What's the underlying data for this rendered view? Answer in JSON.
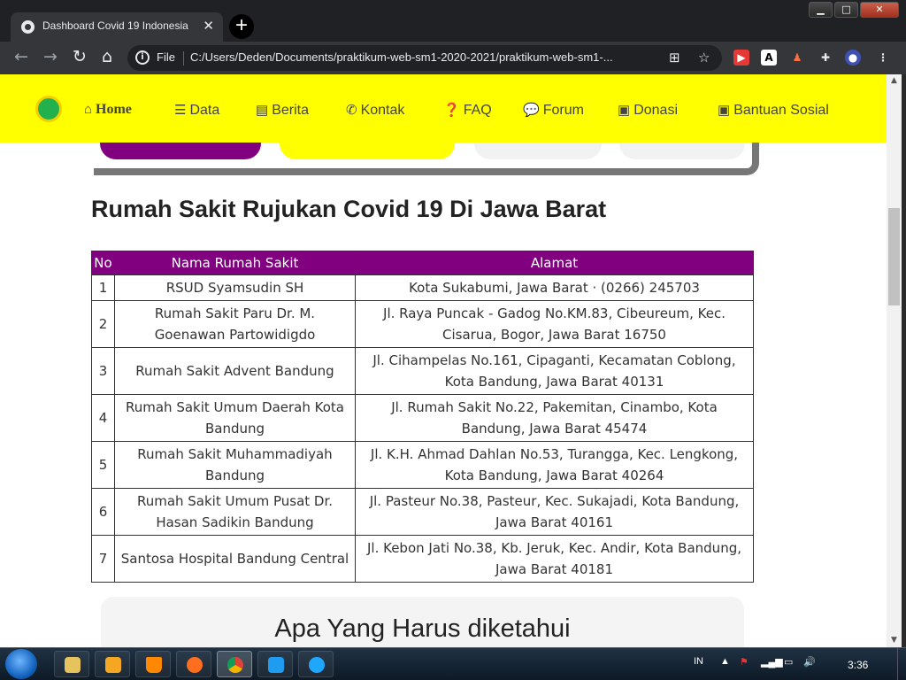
{
  "browser": {
    "tab_title": "Dashboard Covid 19 Indonesia",
    "tab_close": "✕",
    "new_tab": "+",
    "file_label": "File",
    "url": "C:/Users/Deden/Documents/praktikum-web-sm1-2020-2021/praktikum-web-sm1-...",
    "window_buttons": {
      "minimize": "▁",
      "maximize": "□",
      "close": "✕"
    }
  },
  "site_nav": {
    "items": [
      {
        "icon": "home-icon",
        "label": "Home",
        "active": true
      },
      {
        "icon": "database-icon",
        "label": "Data"
      },
      {
        "icon": "newspaper-icon",
        "label": "Berita"
      },
      {
        "icon": "phone-icon",
        "label": "Kontak"
      },
      {
        "icon": "question-circle-icon",
        "label": "FAQ"
      },
      {
        "icon": "comment-icon",
        "label": "Forum"
      },
      {
        "icon": "box-open-icon",
        "label": "Donasi"
      },
      {
        "icon": "box-open-icon",
        "label": "Bantuan Sosial"
      }
    ]
  },
  "colors": {
    "nav_bg": "#ffff00",
    "table_header_bg": "#800080",
    "pill_purple": "#800080",
    "pill_yellow": "#ffff00"
  },
  "section": {
    "title": "Rumah Sakit Rujukan Covid 19 Di Jawa Barat"
  },
  "table": {
    "headers": [
      "No",
      "Nama Rumah Sakit",
      "Alamat"
    ],
    "rows": [
      {
        "no": "1",
        "nama": "RSUD Syamsudin SH",
        "alamat": "Kota Sukabumi, Jawa Barat · (0266) 245703"
      },
      {
        "no": "2",
        "nama": "Rumah Sakit Paru Dr. M. Goenawan Partowidigdo",
        "alamat": "Jl. Raya Puncak - Gadog No.KM.83, Cibeureum, Kec. Cisarua, Bogor, Jawa Barat 16750"
      },
      {
        "no": "3",
        "nama": "Rumah Sakit Advent Bandung",
        "alamat": "Jl. Cihampelas No.161, Cipaganti, Kecamatan Coblong, Kota Bandung, Jawa Barat 40131"
      },
      {
        "no": "4",
        "nama": "Rumah Sakit Umum Daerah Kota Bandung",
        "alamat": "Jl. Rumah Sakit No.22, Pakemitan, Cinambo, Kota Bandung, Jawa Barat 45474"
      },
      {
        "no": "5",
        "nama": "Rumah Sakit Muhammadiyah Bandung",
        "alamat": "Jl. K.H. Ahmad Dahlan No.53, Turangga, Kec. Lengkong, Kota Bandung, Jawa Barat 40264"
      },
      {
        "no": "6",
        "nama": "Rumah Sakit Umum Pusat Dr. Hasan Sadikin Bandung",
        "alamat": "Jl. Pasteur No.38, Pasteur, Kec. Sukajadi, Kota Bandung, Jawa Barat 40161"
      },
      {
        "no": "7",
        "nama": "Santosa Hospital Bandung Central",
        "alamat": "Jl. Kebon Jati No.38, Kb. Jeruk, Kec. Andir, Kota Bandung, Jawa Barat 40181"
      }
    ]
  },
  "know_section": {
    "title": "Apa Yang Harus diketahui"
  },
  "taskbar": {
    "lang": "IN",
    "time": "3:36",
    "apps": [
      "explorer",
      "media-player",
      "vlc",
      "firefox",
      "chrome",
      "vscode",
      "internet-explorer"
    ]
  }
}
